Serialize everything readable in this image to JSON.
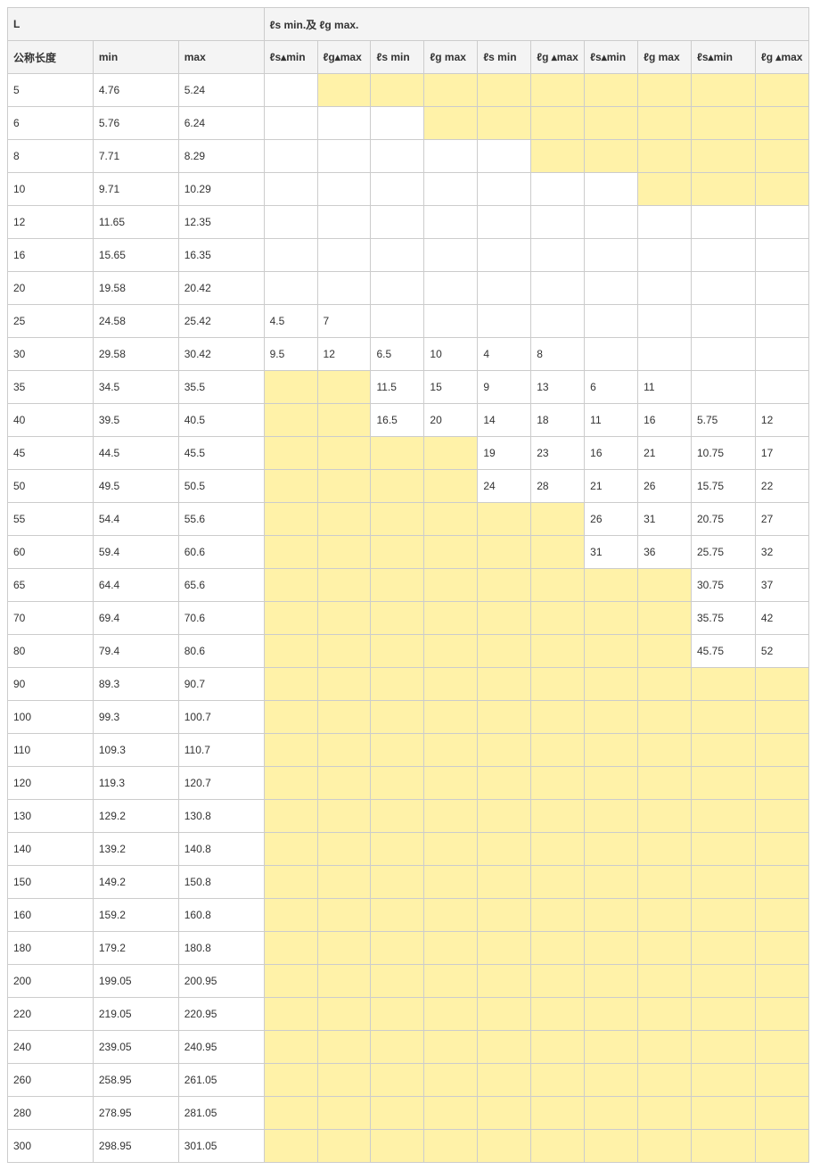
{
  "headers": {
    "top_left": "L",
    "top_right": "ℓs min.及 ℓg   max.",
    "row2": [
      "公称长度",
      "min",
      "max",
      "ℓs▴min",
      "ℓg▴max",
      "ℓs min",
      "ℓg max",
      "ℓs min",
      "ℓg ▴max",
      "ℓs▴min",
      "ℓg max",
      "ℓs▴min",
      "ℓg ▴max"
    ]
  },
  "rows": [
    {
      "v": [
        "5",
        "4.76",
        "5.24",
        "",
        "",
        "",
        "",
        "",
        "",
        "",
        "",
        "",
        ""
      ],
      "hl": [
        4,
        5,
        6,
        7,
        8,
        9,
        10,
        11,
        12
      ]
    },
    {
      "v": [
        "6",
        "5.76",
        "6.24",
        "",
        "",
        "",
        "",
        "",
        "",
        "",
        "",
        "",
        ""
      ],
      "hl": [
        6,
        7,
        8,
        9,
        10,
        11,
        12
      ]
    },
    {
      "v": [
        "8",
        "7.71",
        "8.29",
        "",
        "",
        "",
        "",
        "",
        "",
        "",
        "",
        "",
        ""
      ],
      "hl": [
        8,
        9,
        10,
        11,
        12
      ]
    },
    {
      "v": [
        "10",
        "9.71",
        "10.29",
        "",
        "",
        "",
        "",
        "",
        "",
        "",
        "",
        "",
        ""
      ],
      "hl": [
        10,
        11,
        12
      ]
    },
    {
      "v": [
        "12",
        "11.65",
        "12.35",
        "",
        "",
        "",
        "",
        "",
        "",
        "",
        "",
        "",
        ""
      ],
      "hl": []
    },
    {
      "v": [
        "16",
        "15.65",
        "16.35",
        "",
        "",
        "",
        "",
        "",
        "",
        "",
        "",
        "",
        ""
      ],
      "hl": []
    },
    {
      "v": [
        "20",
        "19.58",
        "20.42",
        "",
        "",
        "",
        "",
        "",
        "",
        "",
        "",
        "",
        ""
      ],
      "hl": []
    },
    {
      "v": [
        "25",
        "24.58",
        "25.42",
        "4.5",
        "7",
        "",
        "",
        "",
        "",
        "",
        "",
        "",
        ""
      ],
      "hl": []
    },
    {
      "v": [
        "30",
        "29.58",
        "30.42",
        "9.5",
        "12",
        "6.5",
        "10",
        "4",
        "8",
        "",
        "",
        "",
        ""
      ],
      "hl": []
    },
    {
      "v": [
        "35",
        "34.5",
        "35.5",
        "",
        "",
        "11.5",
        "15",
        "9",
        "13",
        "6",
        "11",
        "",
        ""
      ],
      "hl": [
        3,
        4
      ]
    },
    {
      "v": [
        "40",
        "39.5",
        "40.5",
        "",
        "",
        "16.5",
        "20",
        "14",
        "18",
        "11",
        "16",
        "5.75",
        "12"
      ],
      "hl": [
        3,
        4
      ]
    },
    {
      "v": [
        "45",
        "44.5",
        "45.5",
        "",
        "",
        "",
        "",
        "19",
        "23",
        "16",
        "21",
        "10.75",
        "17"
      ],
      "hl": [
        3,
        4,
        5,
        6
      ]
    },
    {
      "v": [
        "50",
        "49.5",
        "50.5",
        "",
        "",
        "",
        "",
        "24",
        "28",
        "21",
        "26",
        "15.75",
        "22"
      ],
      "hl": [
        3,
        4,
        5,
        6
      ]
    },
    {
      "v": [
        "55",
        "54.4",
        "55.6",
        "",
        "",
        "",
        "",
        "",
        "",
        "26",
        "31",
        "20.75",
        "27"
      ],
      "hl": [
        3,
        4,
        5,
        6,
        7,
        8
      ]
    },
    {
      "v": [
        "60",
        "59.4",
        "60.6",
        "",
        "",
        "",
        "",
        "",
        "",
        "31",
        "36",
        "25.75",
        "32"
      ],
      "hl": [
        3,
        4,
        5,
        6,
        7,
        8
      ]
    },
    {
      "v": [
        "65",
        "64.4",
        "65.6",
        "",
        "",
        "",
        "",
        "",
        "",
        "",
        "",
        "30.75",
        "37"
      ],
      "hl": [
        3,
        4,
        5,
        6,
        7,
        8,
        9,
        10
      ]
    },
    {
      "v": [
        "70",
        "69.4",
        "70.6",
        "",
        "",
        "",
        "",
        "",
        "",
        "",
        "",
        "35.75",
        "42"
      ],
      "hl": [
        3,
        4,
        5,
        6,
        7,
        8,
        9,
        10
      ]
    },
    {
      "v": [
        "80",
        "79.4",
        "80.6",
        "",
        "",
        "",
        "",
        "",
        "",
        "",
        "",
        "45.75",
        "52"
      ],
      "hl": [
        3,
        4,
        5,
        6,
        7,
        8,
        9,
        10
      ]
    },
    {
      "v": [
        "90",
        "89.3",
        "90.7",
        "",
        "",
        "",
        "",
        "",
        "",
        "",
        "",
        "",
        ""
      ],
      "hl": [
        3,
        4,
        5,
        6,
        7,
        8,
        9,
        10,
        11,
        12
      ]
    },
    {
      "v": [
        "100",
        "99.3",
        "100.7",
        "",
        "",
        "",
        "",
        "",
        "",
        "",
        "",
        "",
        ""
      ],
      "hl": [
        3,
        4,
        5,
        6,
        7,
        8,
        9,
        10,
        11,
        12
      ]
    },
    {
      "v": [
        "110",
        "109.3",
        "110.7",
        "",
        "",
        "",
        "",
        "",
        "",
        "",
        "",
        "",
        ""
      ],
      "hl": [
        3,
        4,
        5,
        6,
        7,
        8,
        9,
        10,
        11,
        12
      ]
    },
    {
      "v": [
        "120",
        "119.3",
        "120.7",
        "",
        "",
        "",
        "",
        "",
        "",
        "",
        "",
        "",
        ""
      ],
      "hl": [
        3,
        4,
        5,
        6,
        7,
        8,
        9,
        10,
        11,
        12
      ]
    },
    {
      "v": [
        "130",
        "129.2",
        "130.8",
        "",
        "",
        "",
        "",
        "",
        "",
        "",
        "",
        "",
        ""
      ],
      "hl": [
        3,
        4,
        5,
        6,
        7,
        8,
        9,
        10,
        11,
        12
      ]
    },
    {
      "v": [
        "140",
        "139.2",
        "140.8",
        "",
        "",
        "",
        "",
        "",
        "",
        "",
        "",
        "",
        ""
      ],
      "hl": [
        3,
        4,
        5,
        6,
        7,
        8,
        9,
        10,
        11,
        12
      ]
    },
    {
      "v": [
        "150",
        "149.2",
        "150.8",
        "",
        "",
        "",
        "",
        "",
        "",
        "",
        "",
        "",
        ""
      ],
      "hl": [
        3,
        4,
        5,
        6,
        7,
        8,
        9,
        10,
        11,
        12
      ]
    },
    {
      "v": [
        "160",
        "159.2",
        "160.8",
        "",
        "",
        "",
        "",
        "",
        "",
        "",
        "",
        "",
        ""
      ],
      "hl": [
        3,
        4,
        5,
        6,
        7,
        8,
        9,
        10,
        11,
        12
      ]
    },
    {
      "v": [
        "180",
        "179.2",
        "180.8",
        "",
        "",
        "",
        "",
        "",
        "",
        "",
        "",
        "",
        ""
      ],
      "hl": [
        3,
        4,
        5,
        6,
        7,
        8,
        9,
        10,
        11,
        12
      ]
    },
    {
      "v": [
        "200",
        "199.05",
        "200.95",
        "",
        "",
        "",
        "",
        "",
        "",
        "",
        "",
        "",
        ""
      ],
      "hl": [
        3,
        4,
        5,
        6,
        7,
        8,
        9,
        10,
        11,
        12
      ]
    },
    {
      "v": [
        "220",
        "219.05",
        "220.95",
        "",
        "",
        "",
        "",
        "",
        "",
        "",
        "",
        "",
        ""
      ],
      "hl": [
        3,
        4,
        5,
        6,
        7,
        8,
        9,
        10,
        11,
        12
      ]
    },
    {
      "v": [
        "240",
        "239.05",
        "240.95",
        "",
        "",
        "",
        "",
        "",
        "",
        "",
        "",
        "",
        ""
      ],
      "hl": [
        3,
        4,
        5,
        6,
        7,
        8,
        9,
        10,
        11,
        12
      ]
    },
    {
      "v": [
        "260",
        "258.95",
        "261.05",
        "",
        "",
        "",
        "",
        "",
        "",
        "",
        "",
        "",
        ""
      ],
      "hl": [
        3,
        4,
        5,
        6,
        7,
        8,
        9,
        10,
        11,
        12
      ]
    },
    {
      "v": [
        "280",
        "278.95",
        "281.05",
        "",
        "",
        "",
        "",
        "",
        "",
        "",
        "",
        "",
        ""
      ],
      "hl": [
        3,
        4,
        5,
        6,
        7,
        8,
        9,
        10,
        11,
        12
      ]
    },
    {
      "v": [
        "300",
        "298.95",
        "301.05",
        "",
        "",
        "",
        "",
        "",
        "",
        "",
        "",
        "",
        ""
      ],
      "hl": [
        3,
        4,
        5,
        6,
        7,
        8,
        9,
        10,
        11,
        12
      ]
    }
  ]
}
